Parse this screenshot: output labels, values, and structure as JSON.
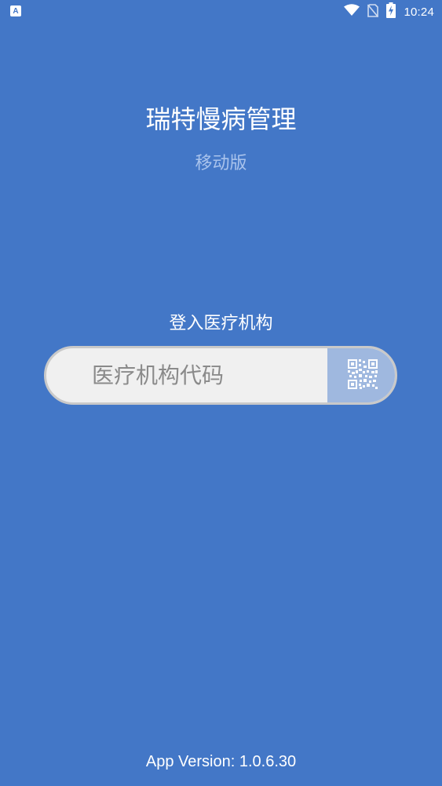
{
  "status_bar": {
    "app_icon_letter": "A",
    "time": "10:24",
    "icons": [
      "wifi-icon",
      "no-sim-icon",
      "battery-charging-icon"
    ]
  },
  "app": {
    "title": "瑞特慢病管理",
    "subtitle": "移动版"
  },
  "login": {
    "heading": "登入医疗机构",
    "input_placeholder": "医疗机构代码",
    "input_value": "",
    "scan_icon": "qr-code-icon"
  },
  "footer": {
    "version_text": "App Version: 1.0.6.30"
  },
  "colors": {
    "background": "#4377c7",
    "subtitle": "#a9c3ec",
    "input_bg": "#f0f0f0",
    "scan_button_bg": "#9fb8df"
  }
}
